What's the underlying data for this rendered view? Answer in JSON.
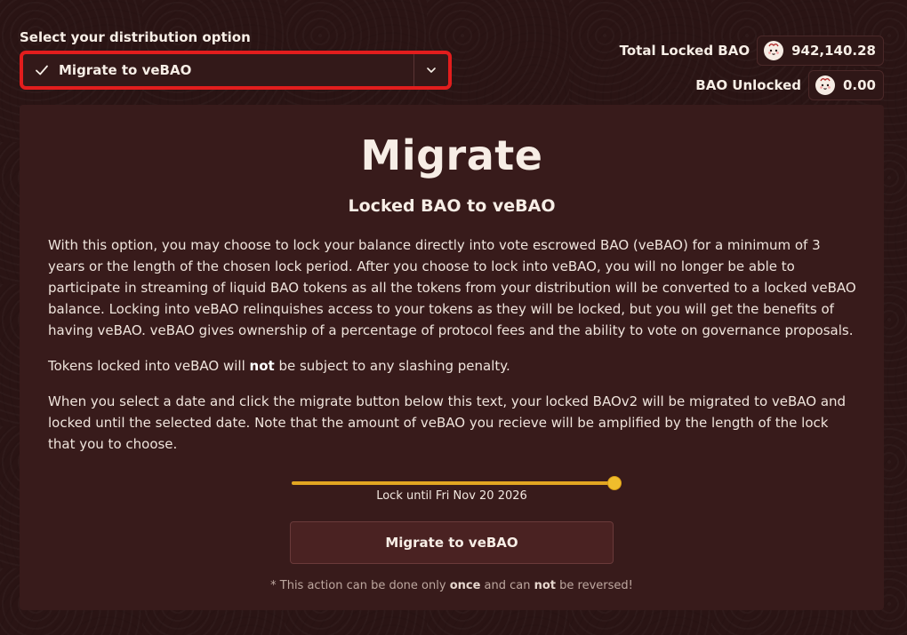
{
  "distribution": {
    "label": "Select your distribution option",
    "selected": "Migrate to veBAO"
  },
  "stats": {
    "total_locked_label": "Total Locked BAO",
    "total_locked_value": "942,140.28",
    "unlocked_label": "BAO Unlocked",
    "unlocked_value": "0.00"
  },
  "card": {
    "title": "Migrate",
    "subtitle": "Locked BAO to veBAO",
    "paragraph1": "With this option, you may choose to lock your balance directly into vote escrowed BAO (veBAO) for a minimum of 3 years or the length of the chosen lock period. After you choose to lock into veBAO, you will no longer be able to participate in streaming of liquid BAO tokens as all the tokens from your distribution will be converted to a locked veBAO balance. Locking into veBAO relinquishes access to your tokens as they will be locked, but you will get the benefits of having veBAO. veBAO gives ownership of a percentage of protocol fees and the ability to vote on governance proposals.",
    "paragraph2_pre": "Tokens locked into veBAO will ",
    "paragraph2_bold": "not",
    "paragraph2_post": " be subject to any slashing penalty.",
    "paragraph3": "When you select a date and click the migrate button below this text, your locked BAOv2 will be migrated to veBAO and locked until the selected date. Note that the amount of veBAO you recieve will be amplified by the length of the lock that you to choose.",
    "slider_fraction": 1.0,
    "lock_label": "Lock until Fri Nov 20 2026",
    "button_label": "Migrate to veBAO",
    "footnote_pre": "* This action can be done only ",
    "footnote_bold1": "once",
    "footnote_mid": " and can ",
    "footnote_bold2": "not",
    "footnote_post": " be reversed!"
  },
  "colors": {
    "background": "#2a1414",
    "card": "#381b1b",
    "highlight_border": "#e21d1d",
    "slider_accent": "#e2a622"
  },
  "icons": {
    "check": "check-icon",
    "chevron": "chevron-down-icon",
    "token": "bao-token-icon"
  }
}
